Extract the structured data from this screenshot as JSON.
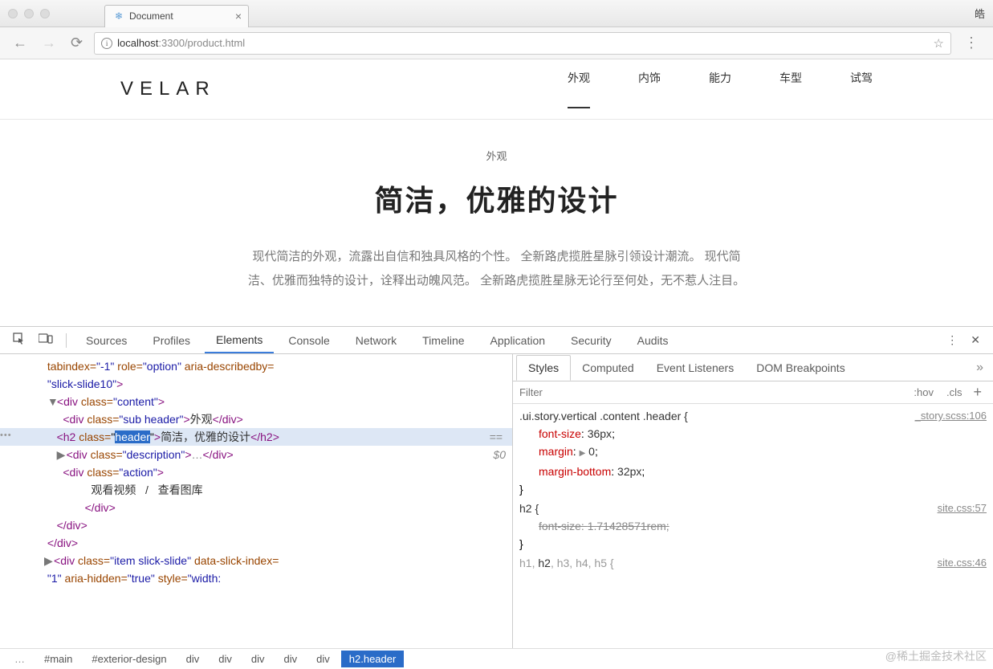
{
  "browser": {
    "tab_title": "Document",
    "titlebar_right": "皓",
    "url_host": "localhost",
    "url_port_path": ":3300/product.html"
  },
  "page": {
    "logo": "VELAR",
    "nav": [
      "外观",
      "内饰",
      "能力",
      "车型",
      "试驾"
    ],
    "sub_header": "外观",
    "main_header": "简洁，优雅的设计",
    "description": "现代简洁的外观，流露出自信和独具风格的个性。 全新路虎揽胜星脉引领设计潮流。 现代简洁、优雅而独特的设计，诠释出动魄风范。 全新路虎揽胜星脉无论行至何处，无不惹人注目。"
  },
  "devtools": {
    "tabs": [
      "Sources",
      "Profiles",
      "Elements",
      "Console",
      "Network",
      "Timeline",
      "Application",
      "Security",
      "Audits"
    ],
    "active_tab": "Elements",
    "styles_tabs": [
      "Styles",
      "Computed",
      "Event Listeners",
      "DOM Breakpoints"
    ],
    "filter_placeholder": "Filter",
    "hov": ":hov",
    "cls": ".cls",
    "dom": {
      "line1_pre": "tabindex=",
      "line1_v1": "\"-1\"",
      "line1_a2": " role=",
      "line1_v2": "\"option\"",
      "line1_a3": " aria-describedby=",
      "line2_val": "\"slick-slide10\"",
      "div_content": "content",
      "div_sub": "sub header",
      "sub_text": "外观",
      "h2_class": "header",
      "h2_text": "简洁，优雅的设计",
      "div_desc": "description",
      "div_action": "action",
      "action_text": "观看视频   /   查看图库",
      "slick_class": "item slick-slide",
      "slick_attr": "data-slick-index=",
      "slick_val": "\"1\"",
      "aria_hidden": " aria-hidden=",
      "aria_val": "\"true\"",
      "style_attr": " style=",
      "style_val": "\"width:",
      "eq": "== ",
      "dollar": "$0"
    },
    "breadcrumb": [
      "#main",
      "#exterior-design",
      "div",
      "div",
      "div",
      "div",
      "div",
      "h2.header"
    ],
    "rules": {
      "r1_sel": ".ui.story.vertical .content .header {",
      "r1_src": "_story.scss:106",
      "r1_p1n": "font-size",
      "r1_p1v": "36px",
      "r1_p2n": "margin",
      "r1_p2v": "0",
      "r1_p3n": "margin-bottom",
      "r1_p3v": "32px",
      "r2_sel": "h2 {",
      "r2_src": "site.css:57",
      "r2_p1n": "font-size",
      "r2_p1v": "1.71428571rem",
      "r3_sel_pre": "h1, ",
      "r3_sel_b": "h2",
      "r3_sel_post": ", h3, h4, h5 {",
      "r3_src": "site.css:46"
    }
  },
  "watermark": "@稀土掘金技术社区"
}
